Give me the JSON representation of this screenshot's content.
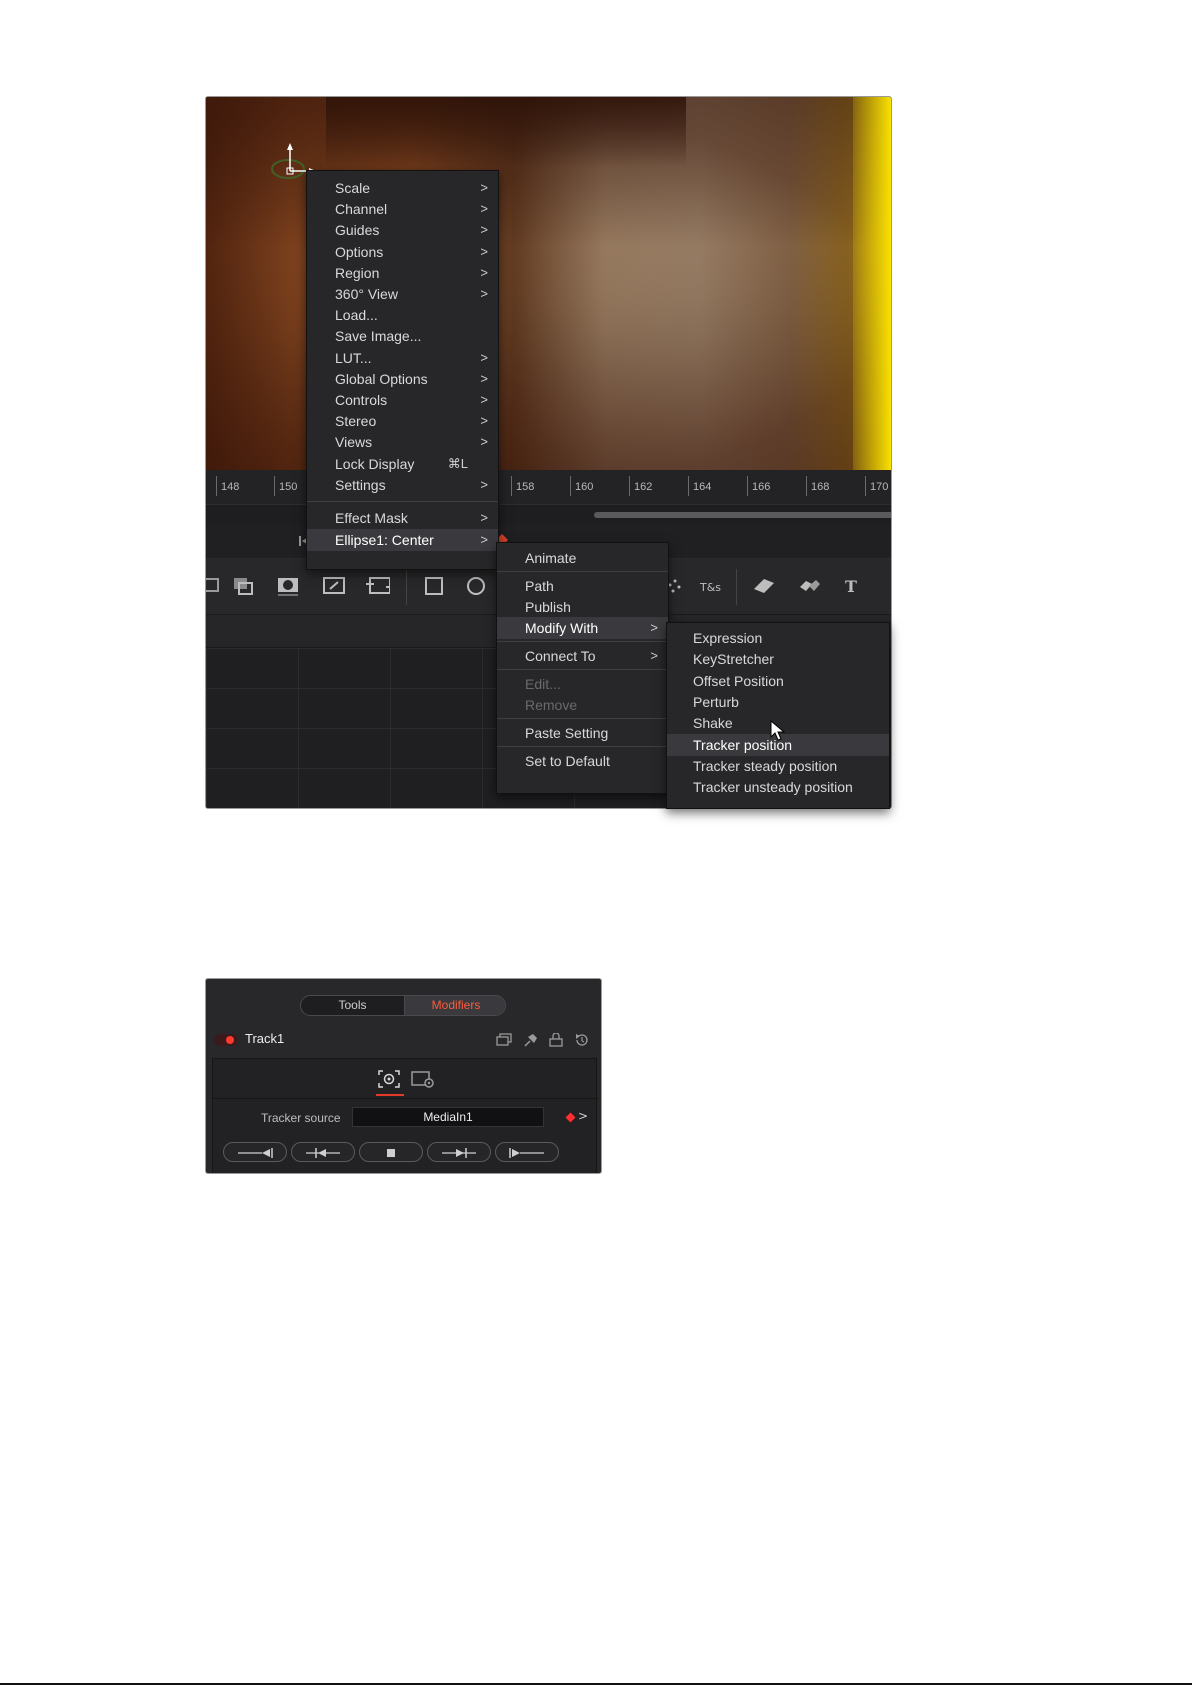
{
  "viewer_menu": {
    "items": [
      {
        "label": "Scale",
        "submenu": true
      },
      {
        "label": "Channel",
        "submenu": true
      },
      {
        "label": "Guides",
        "submenu": true
      },
      {
        "label": "Options",
        "submenu": true
      },
      {
        "label": "Region",
        "submenu": true
      },
      {
        "label": "360° View",
        "submenu": true
      },
      {
        "label": "Load...",
        "submenu": false
      },
      {
        "label": "Save Image...",
        "submenu": false
      },
      {
        "label": "LUT...",
        "submenu": true
      },
      {
        "label": "Global Options",
        "submenu": true
      },
      {
        "label": "Controls",
        "submenu": true
      },
      {
        "label": "Stereo",
        "submenu": true
      },
      {
        "label": "Views",
        "submenu": true
      },
      {
        "label": "Lock Display",
        "shortcut": "⌘L"
      },
      {
        "label": "Settings",
        "submenu": true
      },
      {
        "label": "Effect Mask",
        "submenu": true
      },
      {
        "label": "Ellipse1: Center",
        "submenu": true,
        "highlighted": true
      }
    ]
  },
  "param_menu": {
    "items": [
      {
        "label": "Animate"
      },
      {
        "label": "Path"
      },
      {
        "label": "Publish"
      },
      {
        "label": "Modify With",
        "submenu": true,
        "highlighted": true
      },
      {
        "label": "Connect To",
        "submenu": true
      },
      {
        "label": "Edit...",
        "disabled": true
      },
      {
        "label": "Remove",
        "disabled": true
      },
      {
        "label": "Paste Setting"
      },
      {
        "label": "Set to Default"
      }
    ]
  },
  "modify_menu": {
    "items": [
      {
        "label": "Expression"
      },
      {
        "label": "KeyStretcher"
      },
      {
        "label": "Offset Position"
      },
      {
        "label": "Perturb"
      },
      {
        "label": "Shake"
      },
      {
        "label": "Tracker position",
        "highlighted": true
      },
      {
        "label": "Tracker steady position"
      },
      {
        "label": "Tracker unsteady position"
      }
    ]
  },
  "ruler": {
    "ticks": [
      "148",
      "150",
      "158",
      "160",
      "162",
      "164",
      "166",
      "168",
      "170"
    ]
  },
  "inspector": {
    "tabs": [
      "Tools",
      "Modifiers"
    ],
    "active_tab": "Modifiers",
    "node_name": "Track1",
    "tracker_source_label": "Tracker source",
    "tracker_source_value": "MediaIn1"
  },
  "colors": {
    "accent_red": "#ff3b2f",
    "menu_bg": "#27272a",
    "highlight_bg": "#3a3a3e"
  }
}
